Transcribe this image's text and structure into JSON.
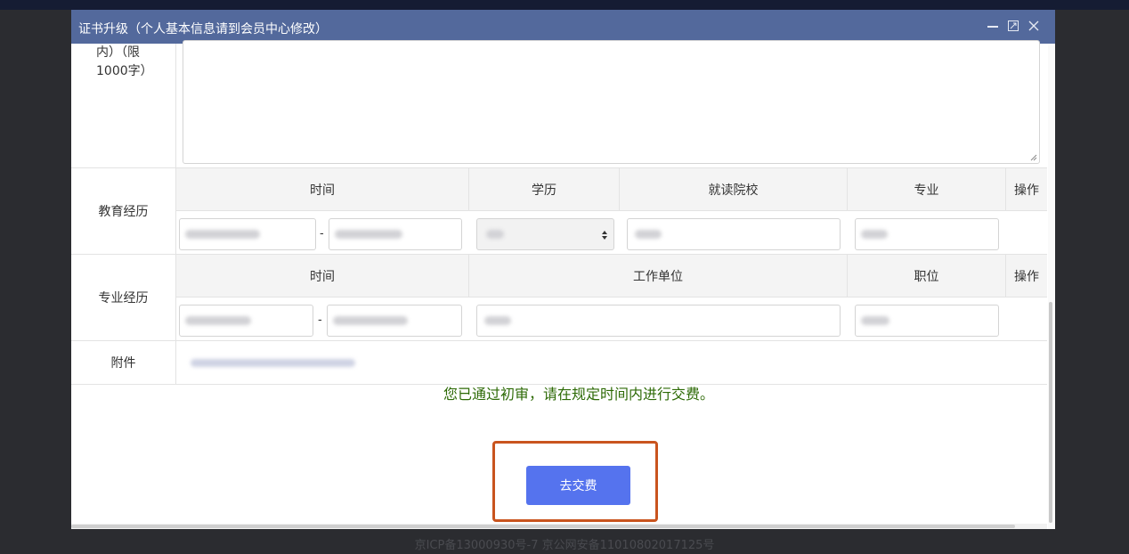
{
  "footer": {
    "icp": "京ICP备13000930号-7 京公网安备11010802017125号"
  },
  "modal": {
    "title": "证书升级（个人基本信息请到会员中心修改）",
    "content_label_line1": "内）（限",
    "content_label_line2": "1000字）",
    "education": {
      "label": "教育经历",
      "headers": {
        "time": "时间",
        "degree": "学历",
        "school": "就读院校",
        "major": "专业",
        "action": "操作"
      },
      "range_separator": "-"
    },
    "work": {
      "label": "专业经历",
      "headers": {
        "time": "时间",
        "company": "工作单位",
        "position": "职位",
        "action": "操作"
      },
      "range_separator": "-"
    },
    "attachment": {
      "label": "附件"
    },
    "notice": "您已通过初审，请在规定时间内进行交费。",
    "pay_button": "去交费"
  },
  "colors": {
    "header": "#53699c",
    "notice": "#2d6a06",
    "button": "#5573ee",
    "highlight": "#c9541e"
  },
  "icons": [
    "minimize-icon",
    "maximize-icon",
    "close-icon",
    "select-arrows-icon",
    "resize-grip-icon"
  ]
}
